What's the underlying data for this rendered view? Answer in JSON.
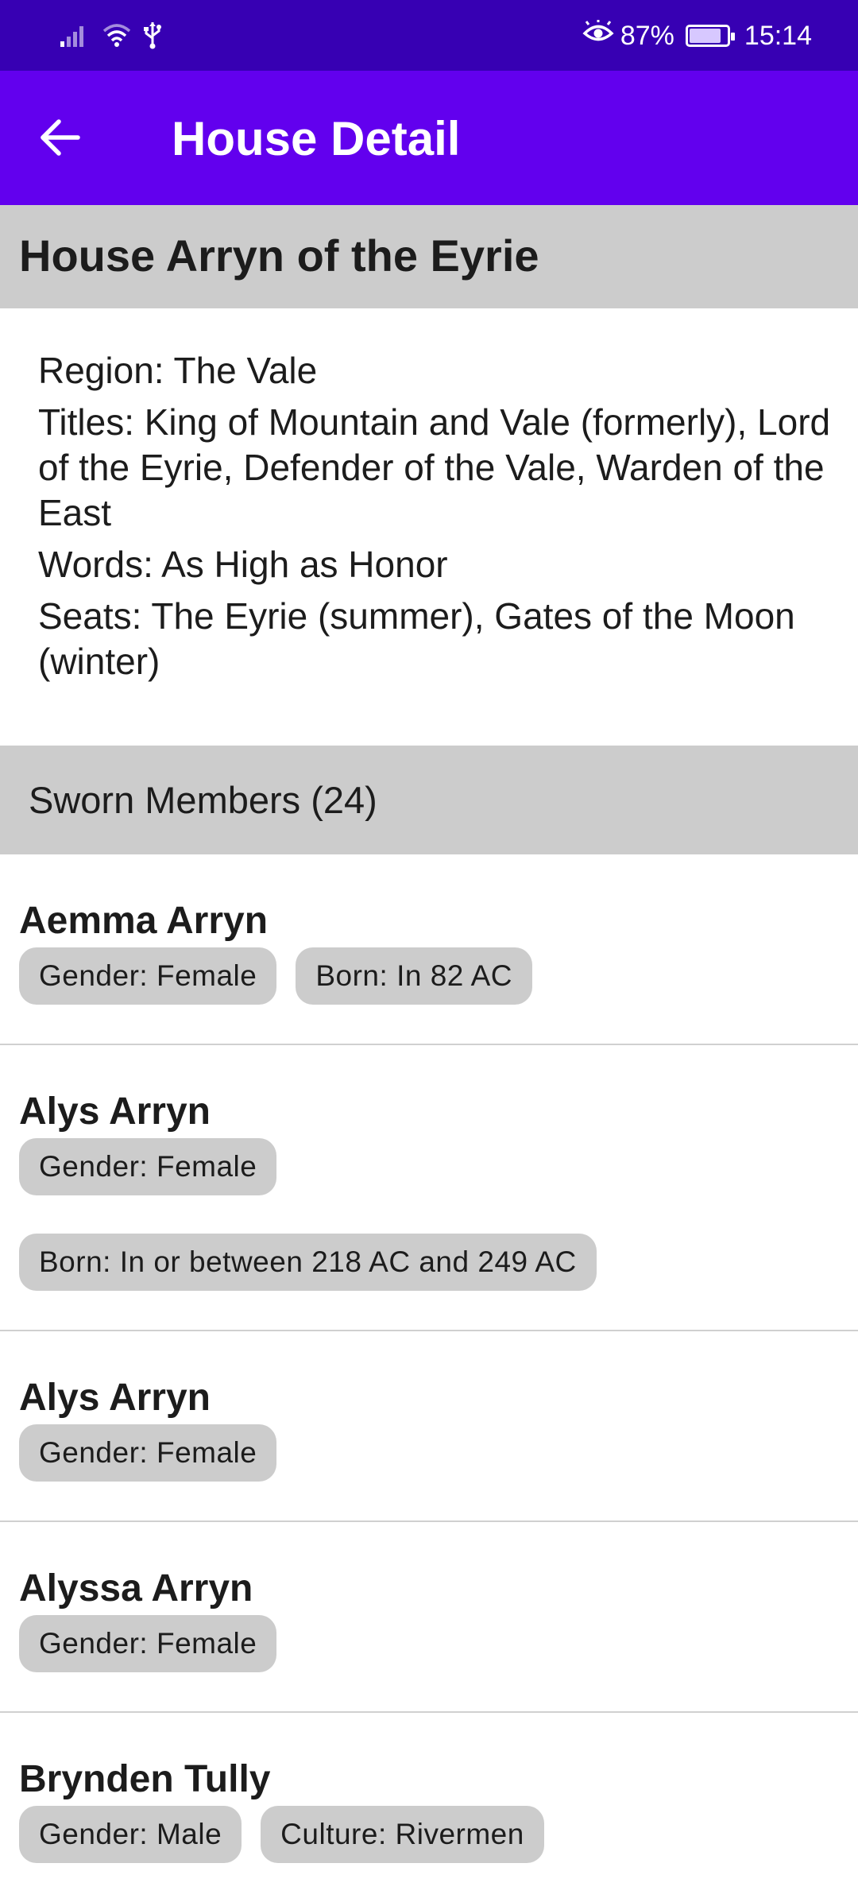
{
  "status_bar": {
    "battery_text": "87%",
    "battery_level": 0.87,
    "time": "15:14",
    "icons": [
      "signal-icon",
      "wifi-icon",
      "usb-icon",
      "eye-comfort-icon",
      "battery-icon"
    ]
  },
  "app_bar": {
    "title": "House Detail",
    "back_icon": "arrow-back-icon",
    "color": "#6200ee",
    "status_color": "#3700b3"
  },
  "house": {
    "name": "House Arryn of the Eyrie",
    "region": "Region: The Vale",
    "titles": "Titles: King of Mountain and Vale (formerly), Lord of the Eyrie, Defender of the Vale, Warden of the East",
    "words": "Words: As High as Honor",
    "seats": "Seats: The Eyrie (summer), Gates of the Moon (winter)"
  },
  "sworn": {
    "title": "Sworn Members (24)"
  },
  "members": [
    {
      "name": "Aemma Arryn",
      "chips": [
        "Gender: Female",
        "Born: In 82 AC"
      ]
    },
    {
      "name": "Alys Arryn",
      "chips": [
        "Gender: Female",
        "Born: In or between 218 AC and 249 AC"
      ]
    },
    {
      "name": "Alys Arryn",
      "chips": [
        "Gender: Female"
      ]
    },
    {
      "name": "Alyssa Arryn",
      "chips": [
        "Gender: Female"
      ]
    },
    {
      "name": "Brynden Tully",
      "chips": [
        "Gender: Male",
        "Culture: Rivermen"
      ]
    }
  ]
}
